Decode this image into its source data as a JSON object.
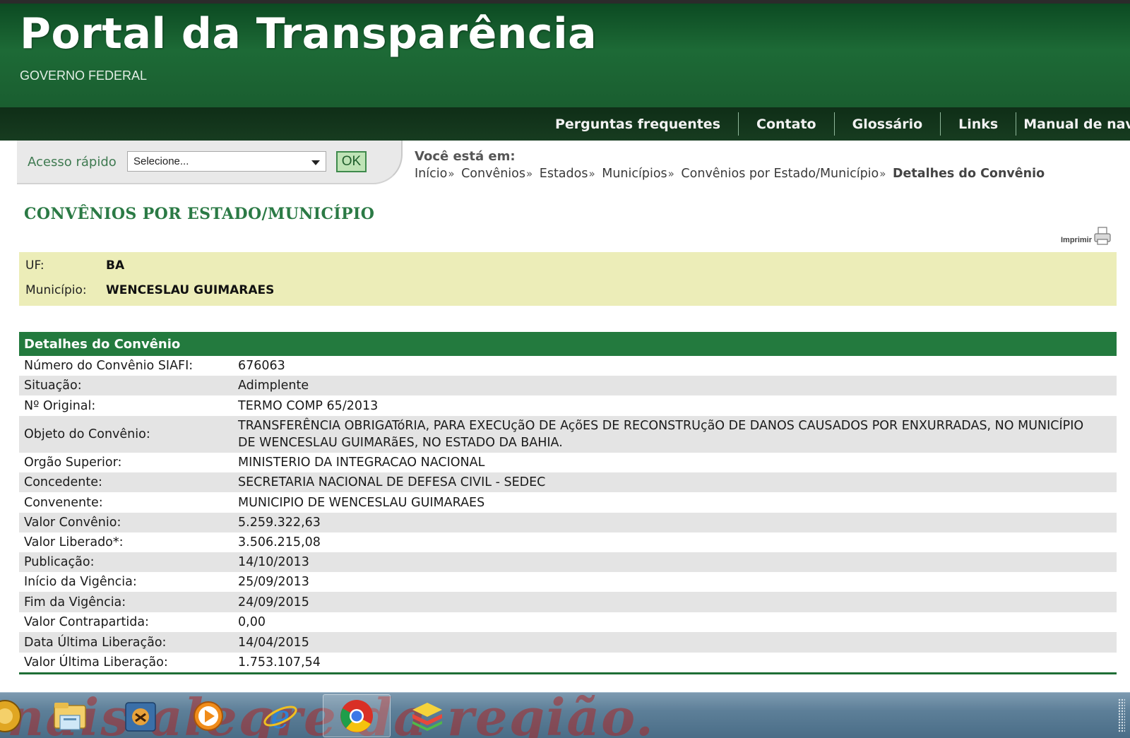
{
  "header": {
    "title": "Portal da Transparência",
    "subtitle": "GOVERNO FEDERAL"
  },
  "nav": {
    "items": [
      "Perguntas frequentes",
      "Contato",
      "Glossário",
      "Links",
      "Manual de navegaçã"
    ]
  },
  "quick_access": {
    "label": "Acesso rápido",
    "select_value": "Selecione...",
    "ok_label": "OK"
  },
  "breadcrumb": {
    "heading": "Você está em:",
    "items": [
      "Início",
      "Convênios",
      "Estados",
      "Municípios",
      "Convênios por Estado/Município"
    ],
    "separator": "»",
    "current": "Detalhes do Convênio"
  },
  "page_title": "CONVÊNIOS POR ESTADO/MUNICÍPIO",
  "print_label": "Imprimir",
  "location": {
    "uf_label": "UF:",
    "uf_value": "BA",
    "municipio_label": "Município:",
    "municipio_value": "WENCESLAU GUIMARAES"
  },
  "details": {
    "heading": "Detalhes do Convênio",
    "rows": [
      {
        "label": "Número do Convênio SIAFI:",
        "value": "676063"
      },
      {
        "label": "Situação:",
        "value": "Adimplente"
      },
      {
        "label": "Nº Original:",
        "value": "TERMO COMP 65/2013"
      },
      {
        "label": "Objeto do Convênio:",
        "value": "TRANSFERÊNCIA OBRIGATóRIA, PARA EXECUçãO DE AçõES DE RECONSTRUçãO DE DANOS CAUSADOS POR ENXURRADAS, NO MUNICÍPIO DE WENCESLAU GUIMARãES, NO ESTADO DA BAHIA."
      },
      {
        "label": "Orgão Superior:",
        "value": "MINISTERIO DA INTEGRACAO NACIONAL"
      },
      {
        "label": "Concedente:",
        "value": "SECRETARIA NACIONAL DE DEFESA CIVIL - SEDEC"
      },
      {
        "label": "Convenente:",
        "value": "MUNICIPIO DE WENCESLAU GUIMARAES"
      },
      {
        "label": "Valor Convênio:",
        "value": "5.259.322,63"
      },
      {
        "label": "Valor Liberado*:",
        "value": "3.506.215,08"
      },
      {
        "label": "Publicação:",
        "value": "14/10/2013"
      },
      {
        "label": "Início da Vigência:",
        "value": "25/09/2013"
      },
      {
        "label": "Fim da Vigência:",
        "value": "24/09/2015"
      },
      {
        "label": "Valor Contrapartida:",
        "value": "0,00"
      },
      {
        "label": "Data Última Liberação:",
        "value": "14/04/2015"
      },
      {
        "label": "Valor Última Liberação:",
        "value": "1.753.107,54"
      }
    ]
  },
  "taskbar": {
    "watermark": "nais alegre da região.",
    "icons": [
      "explorer-icon",
      "media-folder-icon",
      "media-player-icon",
      "internet-explorer-icon",
      "chrome-icon",
      "bluestacks-icon"
    ]
  },
  "colors": {
    "header_green": "#1d6a36",
    "nav_dark": "#173c20",
    "table_head": "#237a3e",
    "location_bg": "#ecedb8",
    "title_green": "#2b7a45"
  }
}
